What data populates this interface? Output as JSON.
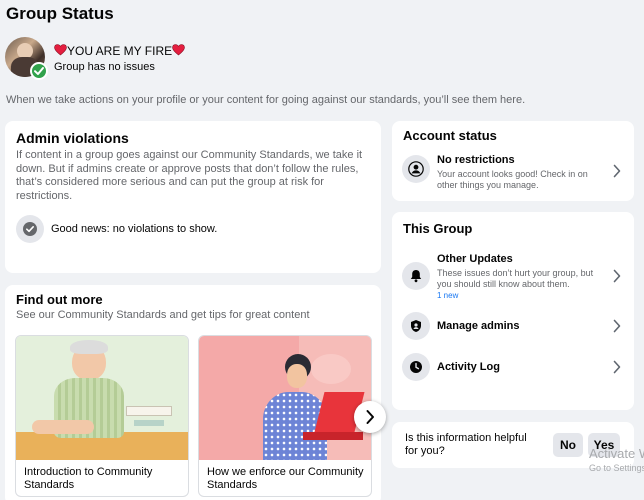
{
  "page_title": "Group Status",
  "group": {
    "name_prefix_emoji": "heart-icon",
    "name": "YOU ARE MY FIRE",
    "status": "Group has no issues"
  },
  "intro": "When we take actions on your profile or your content for going against our standards, you’ll see them here.",
  "admin_violations": {
    "title": "Admin violations",
    "description": "If content in a group goes against our Community Standards, we take it down. But if admins create or approve posts that don’t follow the rules, that’s considered more serious and can put the group at risk for restrictions.",
    "good_news": "Good news: no violations to show."
  },
  "find_out_more": {
    "title": "Find out more",
    "subtitle": "See our Community Standards and get tips for great content",
    "cards": [
      {
        "label": "Introduction to Community Standards"
      },
      {
        "label": "How we enforce our Community Standards"
      }
    ]
  },
  "account_status": {
    "title": "Account status",
    "item_title": "No restrictions",
    "item_desc": "Your account looks good! Check in on other things you manage."
  },
  "this_group": {
    "title": "This Group",
    "items": [
      {
        "title": "Other Updates",
        "desc": "These issues don’t hurt your group, but you should still know about them.",
        "badge": "1 new",
        "icon": "bell-icon"
      },
      {
        "title": "Manage admins",
        "icon": "shield-icon"
      },
      {
        "title": "Activity Log",
        "icon": "clock-icon"
      }
    ]
  },
  "feedback": {
    "question": "Is this information helpful for you?",
    "no": "No",
    "yes": "Yes"
  },
  "watermark": {
    "line1": "Activate Windows",
    "line2": "Go to Settings to activate Windows."
  },
  "colors": {
    "background": "#f0f2f5",
    "card": "#ffffff",
    "accent_blue": "#1877f2",
    "success_green": "#31a24c",
    "heart_red": "#e41e3f"
  }
}
